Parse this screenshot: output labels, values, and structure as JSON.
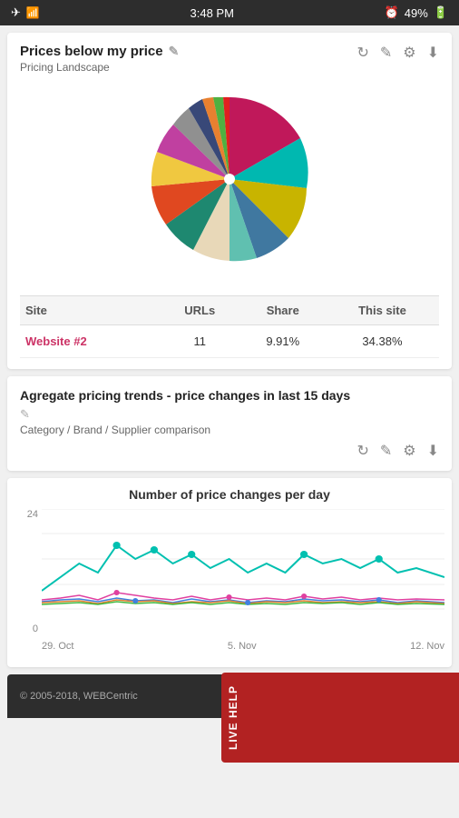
{
  "statusBar": {
    "time": "3:48 PM",
    "battery": "49%"
  },
  "card1": {
    "title": "Prices below my price",
    "subtitle": "Pricing Landscape",
    "table": {
      "headers": [
        "Site",
        "URLs",
        "Share",
        "This site"
      ],
      "rows": [
        {
          "site": "Website #2",
          "urls": "11",
          "share": "9.91%",
          "thisSite": "34.38%"
        }
      ]
    }
  },
  "card2": {
    "title": "Agregate pricing trends - price changes in last 15 days",
    "subtitle": "Category / Brand / Supplier comparison"
  },
  "chart": {
    "title": "Number of price changes per day",
    "yLabels": [
      "24",
      "",
      "",
      "",
      "",
      "0"
    ],
    "xLabels": [
      "29. Oct",
      "5. Nov",
      "12. Nov"
    ]
  },
  "footer": {
    "copyright": "© 2005-2018, WEBCentric"
  },
  "liveHelp": "LIVE HELP",
  "toolbar": {
    "editIcon": "✎",
    "refreshIcon": "⟳",
    "pencilIcon": "✎",
    "gearIcon": "⚙",
    "downloadIcon": "⬇"
  }
}
